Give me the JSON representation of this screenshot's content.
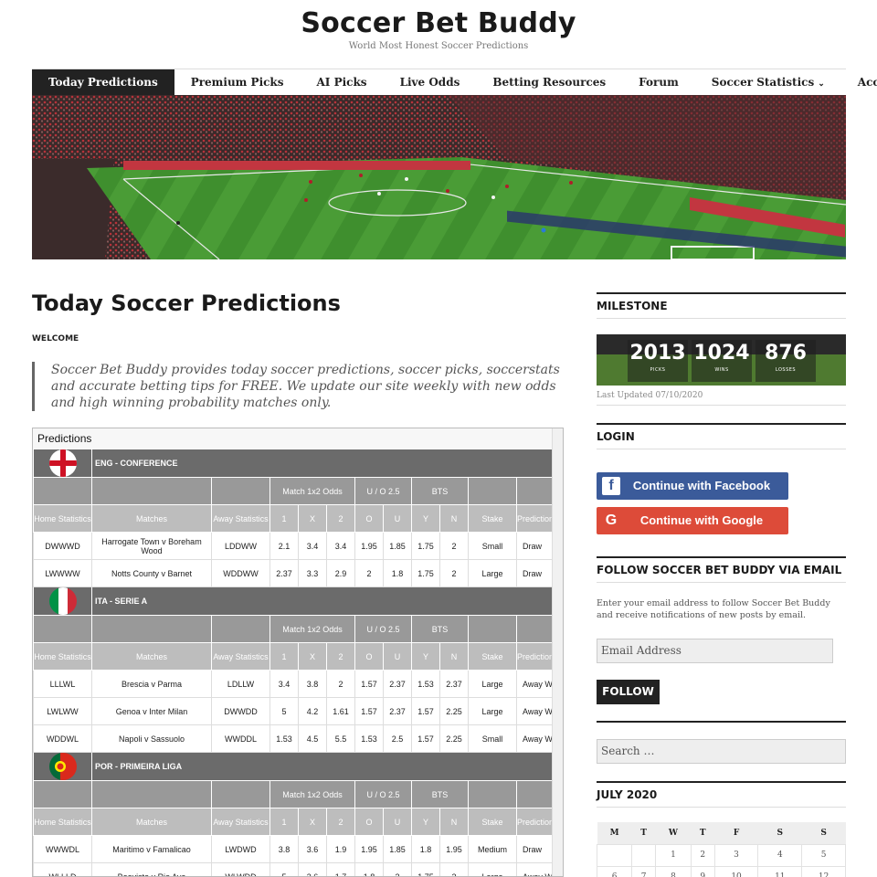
{
  "site": {
    "title": "Soccer Bet Buddy",
    "tagline": "World Most Honest Soccer Predictions"
  },
  "nav": {
    "items": [
      {
        "label": "Today Predictions",
        "active": true
      },
      {
        "label": "Premium Picks"
      },
      {
        "label": "AI Picks"
      },
      {
        "label": "Live Odds"
      },
      {
        "label": "Betting Resources"
      },
      {
        "label": "Forum"
      },
      {
        "label": "Soccer Statistics",
        "dropdown": true
      },
      {
        "label": "Account"
      }
    ]
  },
  "main": {
    "title": "Today Soccer Predictions",
    "welcome": "WELCOME",
    "intro": "Soccer Bet Buddy provides today soccer predictions, soccer picks, soccerstats and accurate betting tips for FREE. We update our site weekly with new odds and high winning probability matches only."
  },
  "predictions": {
    "caption": "Predictions",
    "group_headers": {
      "odds": "Match 1x2 Odds",
      "ou": "U / O 2.5",
      "bts": "BTS"
    },
    "col_headers": {
      "home_stats": "Home Statistics",
      "matches": "Matches",
      "away_stats": "Away Statistics",
      "one": "1",
      "x": "X",
      "two": "2",
      "o": "O",
      "u": "U",
      "y": "Y",
      "n": "N",
      "stake": "Stake",
      "prediction": "Prediction"
    },
    "leagues": [
      {
        "name": "ENG - CONFERENCE",
        "flag": "eng",
        "rows": [
          {
            "home": "DWWWD",
            "match": "Harrogate Town v Boreham Wood",
            "away": "LDDWW",
            "one": "2.1",
            "x": "3.4",
            "two": "3.4",
            "o": "1.95",
            "u": "1.85",
            "y": "1.75",
            "n": "2",
            "stake": "Small",
            "pred": "Draw"
          },
          {
            "home": "LWWWW",
            "match": "Notts County v Barnet",
            "away": "WDDWW",
            "one": "2.37",
            "x": "3.3",
            "two": "2.9",
            "o": "2",
            "u": "1.8",
            "y": "1.75",
            "n": "2",
            "stake": "Large",
            "pred": "Draw"
          }
        ]
      },
      {
        "name": "ITA - SERIE A",
        "flag": "ita",
        "rows": [
          {
            "home": "LLLWL",
            "match": "Brescia v Parma",
            "away": "LDLLW",
            "one": "3.4",
            "x": "3.8",
            "two": "2",
            "o": "1.57",
            "u": "2.37",
            "y": "1.53",
            "n": "2.37",
            "stake": "Large",
            "pred": "Away Win"
          },
          {
            "home": "LWLWW",
            "match": "Genoa v Inter Milan",
            "away": "DWWDD",
            "one": "5",
            "x": "4.2",
            "two": "1.61",
            "o": "1.57",
            "u": "2.37",
            "y": "1.57",
            "n": "2.25",
            "stake": "Large",
            "pred": "Away Win"
          },
          {
            "home": "WDDWL",
            "match": "Napoli v Sassuolo",
            "away": "WWDDL",
            "one": "1.53",
            "x": "4.5",
            "two": "5.5",
            "o": "1.53",
            "u": "2.5",
            "y": "1.57",
            "n": "2.25",
            "stake": "Small",
            "pred": "Away Win"
          }
        ]
      },
      {
        "name": "POR - PRIMEIRA LIGA",
        "flag": "por",
        "rows": [
          {
            "home": "WWWDL",
            "match": "Maritimo v Famalicao",
            "away": "LWDWD",
            "one": "3.8",
            "x": "3.6",
            "two": "1.9",
            "o": "1.95",
            "u": "1.85",
            "y": "1.8",
            "n": "1.95",
            "stake": "Medium",
            "pred": "Draw"
          },
          {
            "home": "WLLLD",
            "match": "Boavista v Rio Ave",
            "away": "WLWDD",
            "one": "5",
            "x": "3.6",
            "two": "1.7",
            "o": "1.8",
            "u": "2",
            "y": "1.75",
            "n": "2",
            "stake": "Large",
            "pred": "Away Win"
          }
        ]
      }
    ]
  },
  "sidebar": {
    "milestone": {
      "title": "MILESTONE",
      "picks": "2013",
      "picks_label": "PICKS",
      "wins": "1024",
      "wins_label": "WINS",
      "losses": "876",
      "losses_label": "LOSSES",
      "last_updated": "Last Updated 07/10/2020"
    },
    "login": {
      "title": "LOGIN",
      "facebook": "Continue with Facebook",
      "google": "Continue with Google",
      "facebook_color": "#3b5b9a",
      "google_color": "#dd4b39"
    },
    "follow": {
      "title": "FOLLOW SOCCER BET BUDDY VIA EMAIL",
      "description": "Enter your email address to follow Soccer Bet Buddy and receive notifications of new posts by email.",
      "email_placeholder": "Email Address",
      "button": "FOLLOW"
    },
    "search": {
      "placeholder": "Search …"
    },
    "calendar": {
      "title": "JULY 2020",
      "weekdays": [
        "M",
        "T",
        "W",
        "T",
        "F",
        "S",
        "S"
      ],
      "weeks": [
        [
          "",
          "",
          "1",
          "2",
          "3",
          "4",
          "5"
        ],
        [
          "6",
          "7",
          "8",
          "9",
          "10",
          "11",
          "12"
        ]
      ]
    }
  }
}
